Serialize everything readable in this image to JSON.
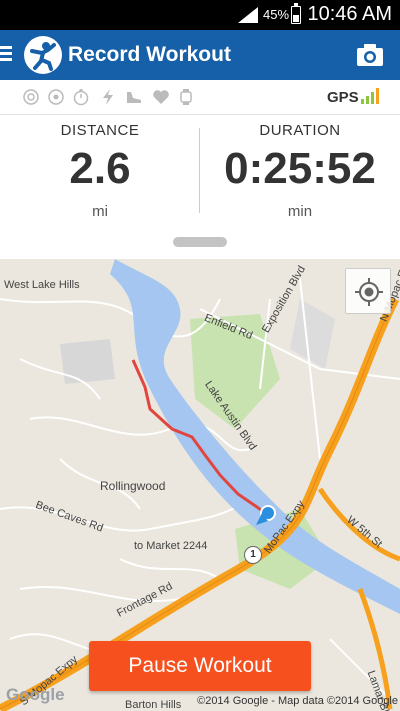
{
  "status_bar": {
    "battery": "45%",
    "time": "10:46 AM"
  },
  "app_bar": {
    "title": "Record Workout"
  },
  "sensors": {
    "icons": [
      "audio-coach-icon",
      "target-icon",
      "timer-icon",
      "lightning-icon",
      "shoe-icon",
      "heart-rate-icon",
      "watch-icon"
    ],
    "gps_label": "GPS"
  },
  "stats": {
    "distance": {
      "label": "DISTANCE",
      "value": "2.6",
      "unit": "mi"
    },
    "duration": {
      "label": "DURATION",
      "value": "0:25:52",
      "unit": "min"
    }
  },
  "map": {
    "labels": {
      "west_lake_hills": "West Lake Hills",
      "enfield": "Enfield Rd",
      "exposition": "Exposition Blvd",
      "lake_austin": "Lake Austin Blvd",
      "rollingwood": "Rollingwood",
      "bee_caves": "Bee Caves Rd",
      "market": "to Market 2244",
      "frontage": "Frontage Rd",
      "mopac": "MoPac Expy",
      "n_mopac": "N Mopac Expy",
      "s_mopac": "S Mopac Expy",
      "w5th": "W 5th St",
      "lamar": "Lamar Blvd",
      "barton": "Barton Hills"
    },
    "road_badge": "1",
    "google": "Google",
    "copyright": "©2014 Google - Map data ©2014 Google"
  },
  "actions": {
    "pause": "Pause Workout"
  },
  "colors": {
    "app_bar": "#1660a9",
    "pause_button": "#f6501e",
    "route": "#e0463f",
    "water": "#a4c6f0",
    "highway": "#f7a01e"
  }
}
